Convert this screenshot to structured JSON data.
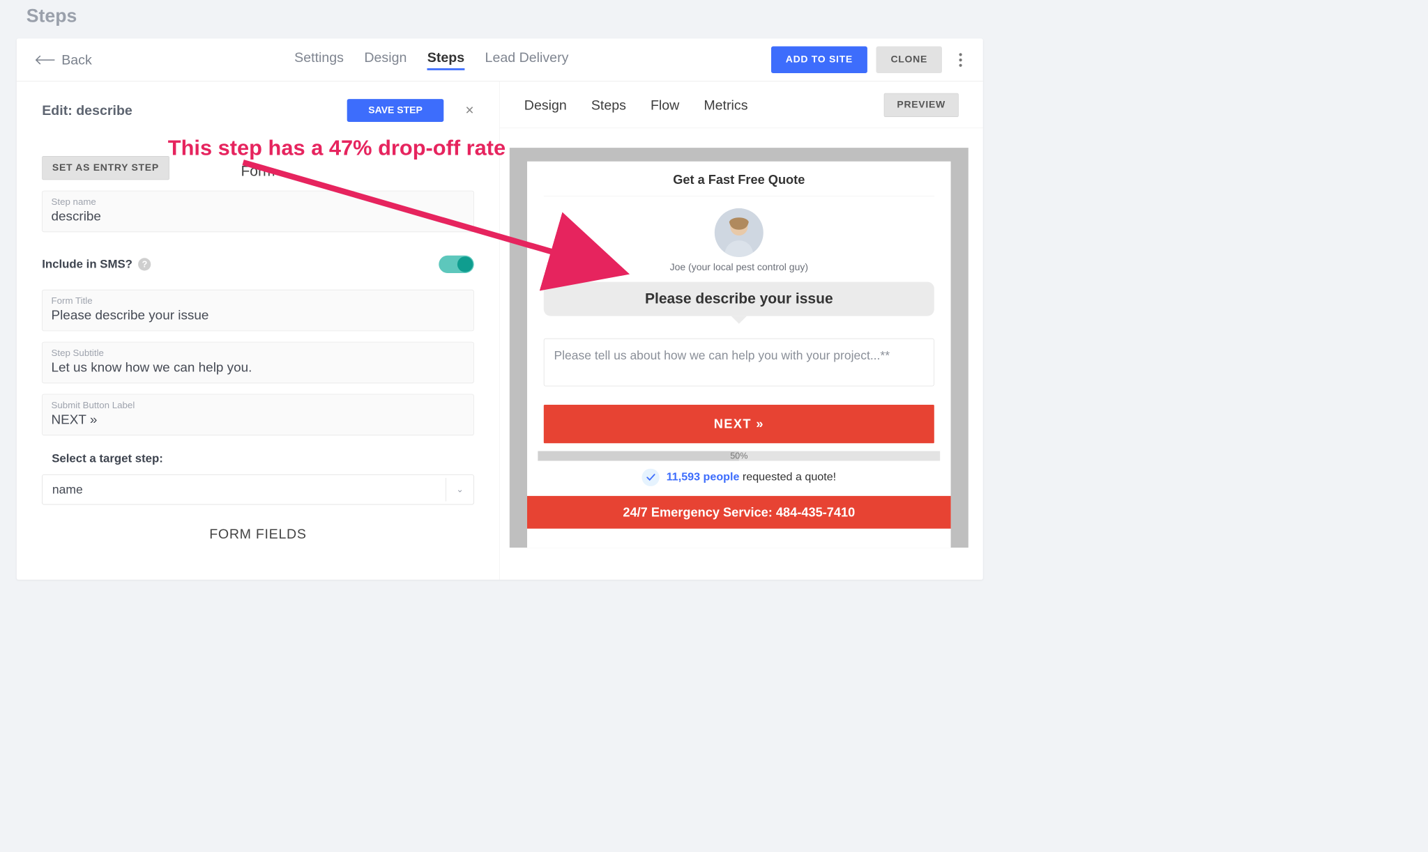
{
  "page_title": "Steps",
  "back_label": "Back",
  "topnav": [
    "Settings",
    "Design",
    "Steps",
    "Lead Delivery"
  ],
  "topnav_active_index": 2,
  "add_to_site": "ADD TO SITE",
  "clone": "CLONE",
  "edit": {
    "title": "Edit: describe",
    "save": "SAVE STEP",
    "set_entry": "SET AS ENTRY STEP",
    "form_heading": "Form",
    "step_name_label": "Step name",
    "step_name_value": "describe",
    "include_sms": "Include in SMS?",
    "include_sms_on": true,
    "form_title_label": "Form Title",
    "form_title_value": "Please describe your issue",
    "subtitle_label": "Step Subtitle",
    "subtitle_value": "Let us know how we can help you.",
    "submit_label_label": "Submit Button Label",
    "submit_label_value": "NEXT »",
    "target_label": "Select a target step:",
    "target_value": "name",
    "form_fields_heading": "FORM FIELDS"
  },
  "preview": {
    "nav": [
      "Design",
      "Steps",
      "Flow",
      "Metrics"
    ],
    "preview_btn": "PREVIEW",
    "widget_title": "Get a Fast Free Quote",
    "avatar_caption": "Joe (your local pest control guy)",
    "bubble": "Please describe your issue",
    "textarea_placeholder": "Please tell us about how we can help you with your project...**",
    "next_label": "NEXT »",
    "progress_pct": "50%",
    "social_count": "11,593 people",
    "social_rest": " requested a quote!",
    "emergency": "24/7 Emergency Service: 484-435-7410"
  },
  "annotation": "This step has a 47% drop-off rate"
}
